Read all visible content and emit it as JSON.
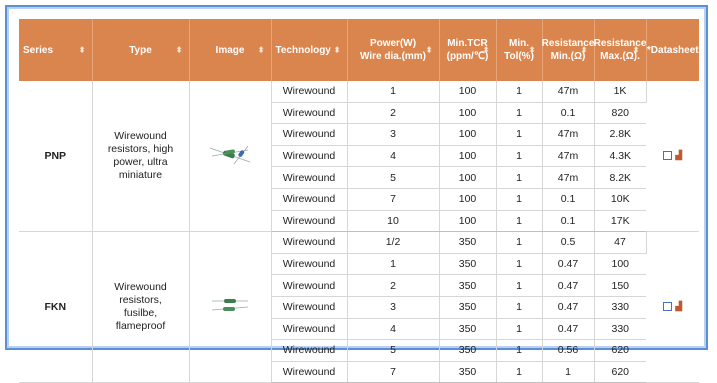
{
  "headers": {
    "series": "Series",
    "type": "Type",
    "image": "Image",
    "technology": "Technology",
    "power_l1": "Power(W)",
    "power_l2": "Wire dia.(mm)",
    "tcr_l1": "Min.TCR",
    "tcr_l2": "(ppm/℃)",
    "tol_l1": "Min.",
    "tol_l2": "Tol(%)",
    "rmin_l1": "Resistance",
    "rmin_l2": "Min.(Ω)",
    "rmax_l1": "Resistance",
    "rmax_l2": "Max.(Ω).",
    "datasheet": "*Datasheet",
    "sort_icon": "⬍"
  },
  "groups": [
    {
      "series": "PNP",
      "type": "Wirewound resistors, high power, ultra miniature",
      "image_icon": "resistor-image-icon",
      "rows": [
        {
          "technology": "Wirewound",
          "power": "1",
          "tcr": "100",
          "tol": "1",
          "rmin": "47m",
          "rmax": "1K"
        },
        {
          "technology": "Wirewound",
          "power": "2",
          "tcr": "100",
          "tol": "1",
          "rmin": "0.1",
          "rmax": "820"
        },
        {
          "technology": "Wirewound",
          "power": "3",
          "tcr": "100",
          "tol": "1",
          "rmin": "47m",
          "rmax": "2.8K"
        },
        {
          "technology": "Wirewound",
          "power": "4",
          "tcr": "100",
          "tol": "1",
          "rmin": "47m",
          "rmax": "4.3K"
        },
        {
          "technology": "Wirewound",
          "power": "5",
          "tcr": "100",
          "tol": "1",
          "rmin": "47m",
          "rmax": "8.2K"
        },
        {
          "technology": "Wirewound",
          "power": "7",
          "tcr": "100",
          "tol": "1",
          "rmin": "0.1",
          "rmax": "10K"
        },
        {
          "technology": "Wirewound",
          "power": "10",
          "tcr": "100",
          "tol": "1",
          "rmin": "0.1",
          "rmax": "17K"
        }
      ]
    },
    {
      "series": "FKN",
      "type": "Wirewound resistors, fusilbe, flameproof",
      "image_icon": "resistor-image-icon",
      "rows": [
        {
          "technology": "Wirewound",
          "power": "1/2",
          "tcr": "350",
          "tol": "1",
          "rmin": "0.5",
          "rmax": "47"
        },
        {
          "technology": "Wirewound",
          "power": "1",
          "tcr": "350",
          "tol": "1",
          "rmin": "0.47",
          "rmax": "100"
        },
        {
          "technology": "Wirewound",
          "power": "2",
          "tcr": "350",
          "tol": "1",
          "rmin": "0.47",
          "rmax": "150"
        },
        {
          "technology": "Wirewound",
          "power": "3",
          "tcr": "350",
          "tol": "1",
          "rmin": "0.47",
          "rmax": "330"
        },
        {
          "technology": "Wirewound",
          "power": "4",
          "tcr": "350",
          "tol": "1",
          "rmin": "0.47",
          "rmax": "330"
        },
        {
          "technology": "Wirewound",
          "power": "5",
          "tcr": "350",
          "tol": "1",
          "rmin": "0.56",
          "rmax": "620"
        },
        {
          "technology": "Wirewound",
          "power": "7",
          "tcr": "350",
          "tol": "1",
          "rmin": "1",
          "rmax": "620"
        }
      ]
    }
  ],
  "datasheet_icons": [
    "pdf-checkbox-icon",
    "chart-icon"
  ],
  "colors": {
    "header_bg": "#d9854d",
    "frame_border": "#5b8fd6"
  }
}
